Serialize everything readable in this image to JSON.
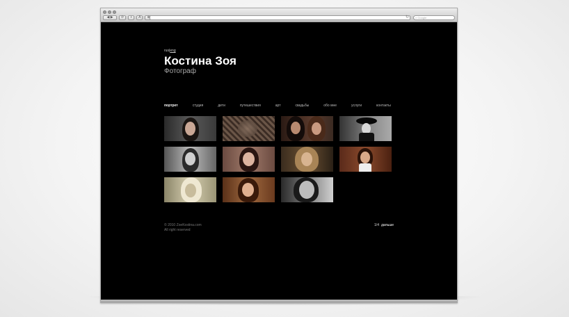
{
  "browser": {
    "search_placeholder": "Google",
    "reload_glyph": "↻",
    "nav_buttons": [
      "◀ ▶",
      "⟳",
      "+",
      "A",
      "⊕"
    ]
  },
  "site": {
    "lang": {
      "ru": "rus",
      "sep": "|",
      "en": "eng"
    },
    "title": "Костина Зоя",
    "subtitle": "Фотограф",
    "menu": [
      {
        "label": "портрет",
        "active": true
      },
      {
        "label": "студия"
      },
      {
        "label": "дети"
      },
      {
        "label": "путешествия"
      },
      {
        "label": "арт"
      },
      {
        "label": "свадьбы"
      },
      {
        "label": "обо мне"
      },
      {
        "label": "услуги"
      },
      {
        "label": "контакты"
      }
    ],
    "footer": {
      "copyright": "© 2010 ZoeKostina.com",
      "rights": "All right reserved",
      "page": "1/4",
      "next": "дальше"
    }
  },
  "thumbnails": [
    "portrait-thumb-1",
    "portrait-thumb-2",
    "portrait-thumb-3",
    "portrait-thumb-4",
    "portrait-thumb-5",
    "portrait-thumb-6",
    "portrait-thumb-7",
    "portrait-thumb-8",
    "portrait-thumb-9",
    "portrait-thumb-10",
    "portrait-thumb-11"
  ],
  "colors": {
    "page_bg": "#000000",
    "text_primary": "#ffffff",
    "text_muted": "#aaaaaa",
    "chrome": "#c9c9c9"
  }
}
